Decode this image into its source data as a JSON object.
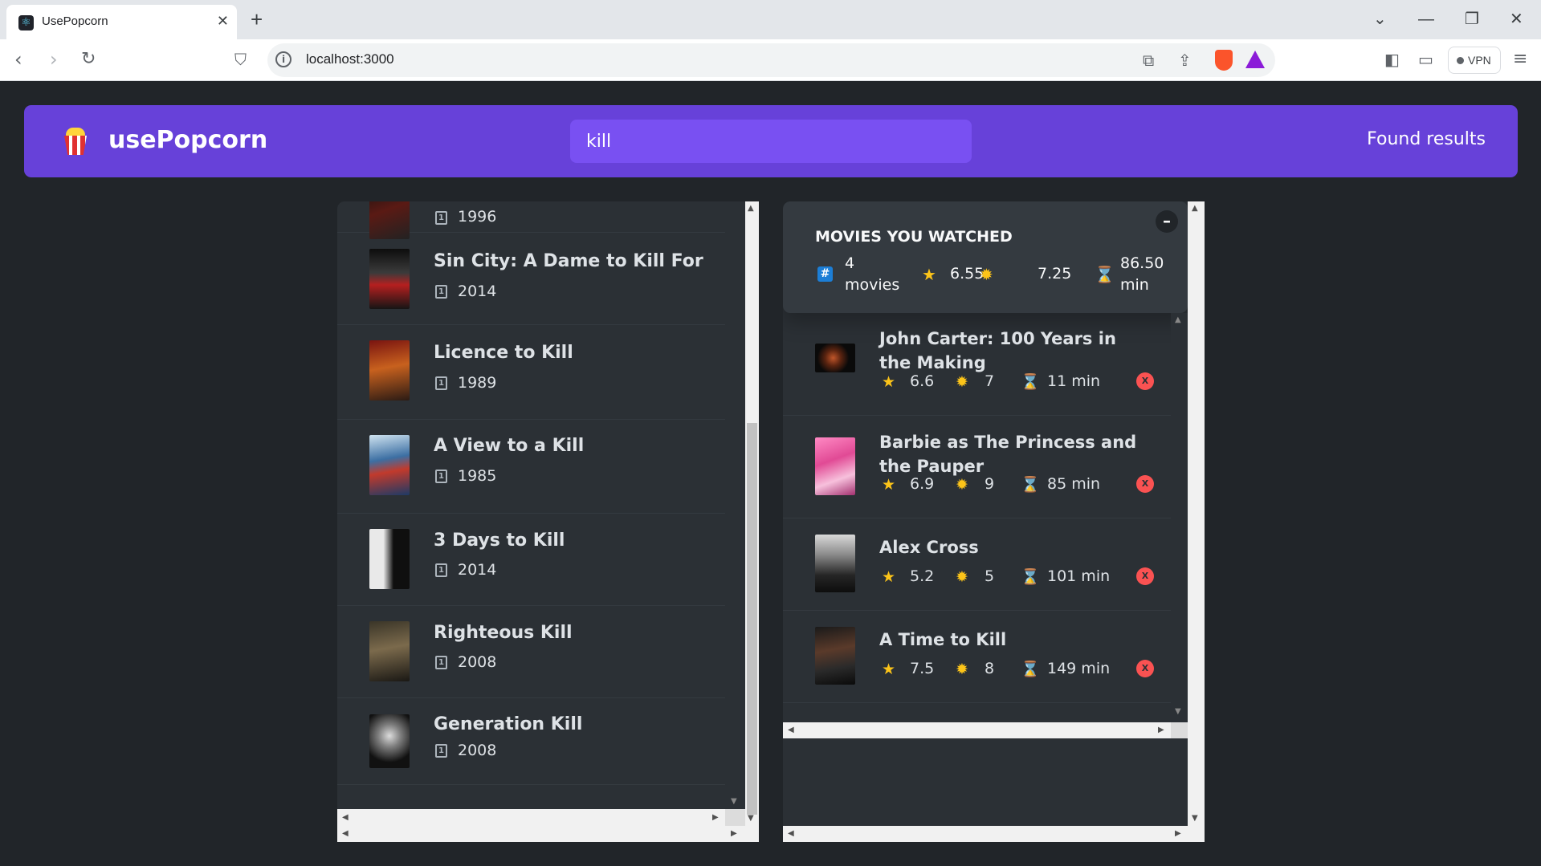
{
  "browser": {
    "tab_title": "UsePopcorn",
    "url": "localhost:3000",
    "vpn_label": "VPN"
  },
  "app": {
    "logo_text": "usePopcorn",
    "search_value": "kill",
    "found_results": "Found results"
  },
  "movies": [
    {
      "title": "",
      "year": "1996"
    },
    {
      "title": "Sin City: A Dame to Kill For",
      "year": "2014"
    },
    {
      "title": "Licence to Kill",
      "year": "1989"
    },
    {
      "title": "A View to a Kill",
      "year": "1985"
    },
    {
      "title": "3 Days to Kill",
      "year": "2014"
    },
    {
      "title": "Righteous Kill",
      "year": "2008"
    },
    {
      "title": "Generation Kill",
      "year": "2008"
    }
  ],
  "summary": {
    "title": "MOVIES YOU WATCHED",
    "toggle": "–",
    "count_value": "4",
    "count_unit": "movies",
    "avg_imdb": "6.55",
    "avg_user": "7.25",
    "avg_runtime": "86.50",
    "runtime_unit": "min"
  },
  "watched": [
    {
      "title": "John Carter: 100 Years in the Making",
      "imdb": "6.6",
      "user": "7",
      "runtime": "11 min"
    },
    {
      "title": "Barbie as The Princess and the Pauper",
      "imdb": "6.9",
      "user": "9",
      "runtime": "85 min"
    },
    {
      "title": "Alex Cross",
      "imdb": "5.2",
      "user": "5",
      "runtime": "101 min"
    },
    {
      "title": "A Time to Kill",
      "imdb": "7.5",
      "user": "8",
      "runtime": "149 min"
    }
  ],
  "delete_label": "X",
  "colors": {
    "background": "#212529",
    "nav": "#6741d9",
    "search": "#7950f2",
    "panel": "#2b3035",
    "summary": "#343a40",
    "star": "#fcc419",
    "delete": "#fa5252"
  }
}
